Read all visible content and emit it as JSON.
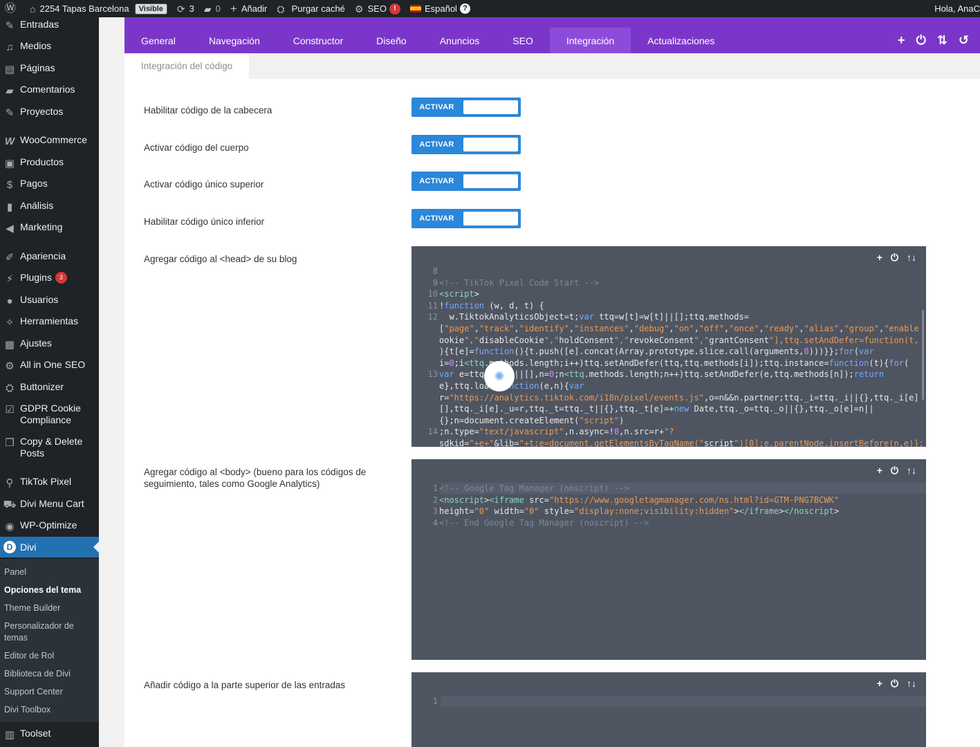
{
  "adminbar": {
    "site_name": "2254 Tapas Barcelona",
    "visible_badge": "Visible",
    "updates_count": "3",
    "comments_count": "0",
    "add_new": "Añadir",
    "purge_cache": "Purgar caché",
    "seo": "SEO",
    "seo_alert": "!",
    "language": "Español",
    "help": "?",
    "greeting": "Hola, AnaC"
  },
  "sidebar": {
    "items": [
      {
        "label": "Entradas",
        "icon": "pin-icon"
      },
      {
        "label": "Medios",
        "icon": "media-icon"
      },
      {
        "label": "Páginas",
        "icon": "pages-icon"
      },
      {
        "label": "Comentarios",
        "icon": "comments-icon"
      },
      {
        "label": "Proyectos",
        "icon": "pin-icon"
      },
      {
        "label": "WooCommerce",
        "icon": "woo-icon"
      },
      {
        "label": "Productos",
        "icon": "products-icon"
      },
      {
        "label": "Pagos",
        "icon": "payments-icon"
      },
      {
        "label": "Análisis",
        "icon": "analytics-icon"
      },
      {
        "label": "Marketing",
        "icon": "megaphone-icon"
      },
      {
        "label": "Apariencia",
        "icon": "brush-icon"
      },
      {
        "label": "Plugins",
        "icon": "plugin-icon",
        "badge": "3"
      },
      {
        "label": "Usuarios",
        "icon": "users-icon"
      },
      {
        "label": "Herramientas",
        "icon": "wrench-icon"
      },
      {
        "label": "Ajustes",
        "icon": "settings-icon"
      },
      {
        "label": "All in One SEO",
        "icon": "aioseo-icon"
      },
      {
        "label": "Buttonizer",
        "icon": "buttonizer-icon"
      },
      {
        "label": "GDPR Cookie Compliance",
        "icon": "check-icon"
      },
      {
        "label": "Copy & Delete Posts",
        "icon": "copy-icon"
      },
      {
        "label": "TikTok Pixel",
        "icon": "search-icon"
      },
      {
        "label": "Divi Menu Cart",
        "icon": "cart-icon"
      },
      {
        "label": "WP-Optimize",
        "icon": "optimize-icon"
      },
      {
        "label": "Divi",
        "icon": "divi-icon"
      },
      {
        "label": "Toolset",
        "icon": "toolset-icon"
      }
    ],
    "submenu": [
      "Panel",
      "Opciones del tema",
      "Theme Builder",
      "Personalizador de temas",
      "Editor de Rol",
      "Biblioteca de Divi",
      "Support Center",
      "Divi Toolbox"
    ]
  },
  "tabs": [
    "General",
    "Navegación",
    "Constructor",
    "Diseño",
    "Anuncios",
    "SEO",
    "Integración",
    "Actualizaciones"
  ],
  "active_tab": "Integración",
  "subtab": "Integración del código",
  "options": [
    {
      "label": "Habilitar código de la cabecera",
      "toggle": "ACTIVAR"
    },
    {
      "label": "Activar código del cuerpo",
      "toggle": "ACTIVAR"
    },
    {
      "label": "Activar código único superior",
      "toggle": "ACTIVAR"
    },
    {
      "label": "Habilitar código único inferior",
      "toggle": "ACTIVAR"
    }
  ],
  "code_fields": [
    {
      "label": "Agregar código al <head> de su blog"
    },
    {
      "label": "Agregar código al <body> (bueno para los códigos de seguimiento, tales como Google Analytics)"
    },
    {
      "label": "Añadir código a la parte superior de las entradas"
    }
  ],
  "editor_tools": {
    "add": "+",
    "power": "⏻",
    "sort": "↑↓"
  },
  "head_code": [
    {
      "n": "8",
      "t": ""
    },
    {
      "n": "9",
      "t": "<!-- TikTok Pixel Code Start -->"
    },
    {
      "n": "10",
      "t": "<script>"
    },
    {
      "n": "11",
      "t": "!function (w, d, t) {"
    },
    {
      "n": "12",
      "t": "  w.TiktokAnalyticsObject=t;var ttq=w[t]=w[t]||[];ttq.methods="
    },
    {
      "n": "",
      "t": "[\"page\",\"track\",\"identify\",\"instances\",\"debug\",\"on\",\"off\",\"once\",\"ready\",\"alias\",\"group\",\"enable"
    },
    {
      "n": "",
      "t": "ookie\",\"disableCookie\",\"holdConsent\",\"revokeConsent\",\"grantConsent\"],ttq.setAndDefer=function(t,"
    },
    {
      "n": "",
      "t": "){t[e]=function(){t.push([e].concat(Array.prototype.slice.call(arguments,0)))}};for(var"
    },
    {
      "n": "",
      "t": "i=0;i<ttq.methods.length;i++)ttq.setAndDefer(ttq,ttq.methods[i]);ttq.instance=function(t){for("
    },
    {
      "n": "13",
      "t": "var e=ttq._i[t]||[],n=0;n<ttq.methods.length;n++)ttq.setAndDefer(e,ttq.methods[n]);return"
    },
    {
      "n": "",
      "t": "e},ttq.load=function(e,n){var"
    },
    {
      "n": "",
      "t": "r=\"https://analytics.tiktok.com/i18n/pixel/events.js\",o=n&&n.partner;ttq._i=ttq._i||{},ttq._i[e]"
    },
    {
      "n": "",
      "t": "[],ttq._i[e]._u=r,ttq._t=ttq._t||{},ttq._t[e]=+new Date,ttq._o=ttq._o||{},ttq._o[e]=n||"
    },
    {
      "n": "",
      "t": "{};n=document.createElement(\"script\")"
    },
    {
      "n": "14",
      "t": ";n.type=\"text/javascript\",n.async=!0,n.src=r+\"?"
    },
    {
      "n": "",
      "t": "sdkid=\"+e+\"&lib=\"+t;e=document.getElementsByTagName(\"script\")[0];e.parentNode.insertBefore(n,e)};"
    }
  ],
  "body_code": [
    {
      "n": "1",
      "t": "<!-- Google Tag Manager (noscript) -->"
    },
    {
      "n": "2",
      "t": "<noscript><iframe src=\"https://www.googletagmanager.com/ns.html?id=GTM-PNG7BCWK\""
    },
    {
      "n": "3",
      "t": "height=\"0\" width=\"0\" style=\"display:none;visibility:hidden\"></iframe></noscript>"
    },
    {
      "n": "4",
      "t": "<!-- End Google Tag Manager (noscript) -->"
    }
  ],
  "top_code": [
    {
      "n": "1",
      "t": ""
    }
  ],
  "colors": {
    "accent_purple": "#7b36c9",
    "toggle_blue": "#2b87da",
    "editor_bg": "#4e5561",
    "admin_dark": "#1d2327",
    "wp_blue": "#2271b1"
  }
}
